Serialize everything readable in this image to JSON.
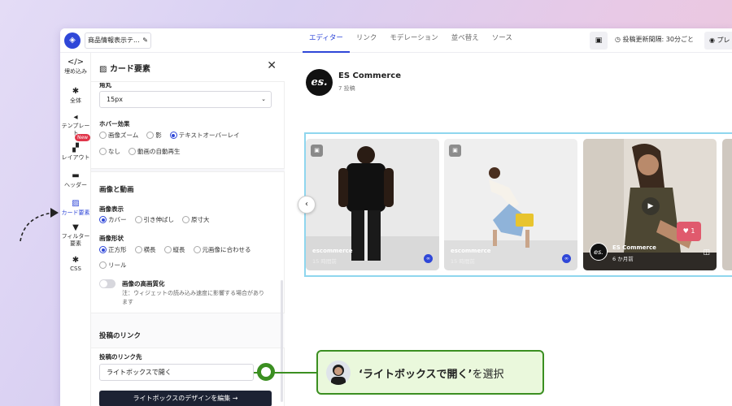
{
  "topbar": {
    "widget_name": "商品情報表示テ...",
    "tabs": [
      "エディター",
      "リンク",
      "モデレーション",
      "並べ替え",
      "ソース"
    ],
    "active_tab": "エディター",
    "refresh_label": "投稿更新間隔: 30分ごと",
    "preview_label": "プレ"
  },
  "iconnav": {
    "items": [
      {
        "label": "埋め込み",
        "icon": "code-icon"
      },
      {
        "label": "全体",
        "icon": "gear-icon"
      },
      {
        "label": "テンプレート",
        "icon": "template-icon"
      },
      {
        "label": "レイアウト",
        "icon": "layout-icon"
      },
      {
        "label": "ヘッダー",
        "icon": "header-icon"
      },
      {
        "label": "カード要素",
        "icon": "image-icon"
      },
      {
        "label": "フィルター要素",
        "icon": "filter-icon"
      },
      {
        "label": "CSS",
        "icon": "gear-icon"
      }
    ],
    "new_badge": "New",
    "active": "カード要素"
  },
  "panel": {
    "title": "カード要素",
    "truncated_label": "角丸",
    "radius_value": "15px",
    "hover": {
      "label": "ホバー効果",
      "options": [
        "画像ズーム",
        "影",
        "テキストオーバーレイ",
        "なし",
        "動画の自動再生"
      ],
      "selected": "テキストオーバーレイ"
    },
    "media_section": "画像と動画",
    "display": {
      "label": "画像表示",
      "options": [
        "カバー",
        "引き伸ばし",
        "原寸大"
      ],
      "selected": "カバー"
    },
    "shape": {
      "label": "画像形状",
      "options": [
        "正方形",
        "横長",
        "縦長",
        "元画像に合わせる",
        "リール"
      ],
      "selected": "正方形"
    },
    "hq": {
      "label": "画像の高画質化",
      "note": "注：ウィジェットの読み込み速度に影響する場合があります"
    },
    "link_section": "投稿のリンク",
    "link_target_label": "投稿のリンク先",
    "link_target_value": "ライトボックスで開く",
    "design_button": "ライトボックスのデザインを編集 →"
  },
  "preview": {
    "brand_logo_text": "es.",
    "brand_name": "ES Commerce",
    "post_count": "7 投稿",
    "cards": [
      {
        "name": "escommerce",
        "time": "15 時間前"
      },
      {
        "name": "escommerce",
        "time": "15 時間前"
      },
      {
        "name": "ES Commerce",
        "time": "6 か月前"
      }
    ],
    "like_count": "1"
  },
  "callout": {
    "quoted": "‘ライトボックスで開く’",
    "suffix": "を選択"
  }
}
